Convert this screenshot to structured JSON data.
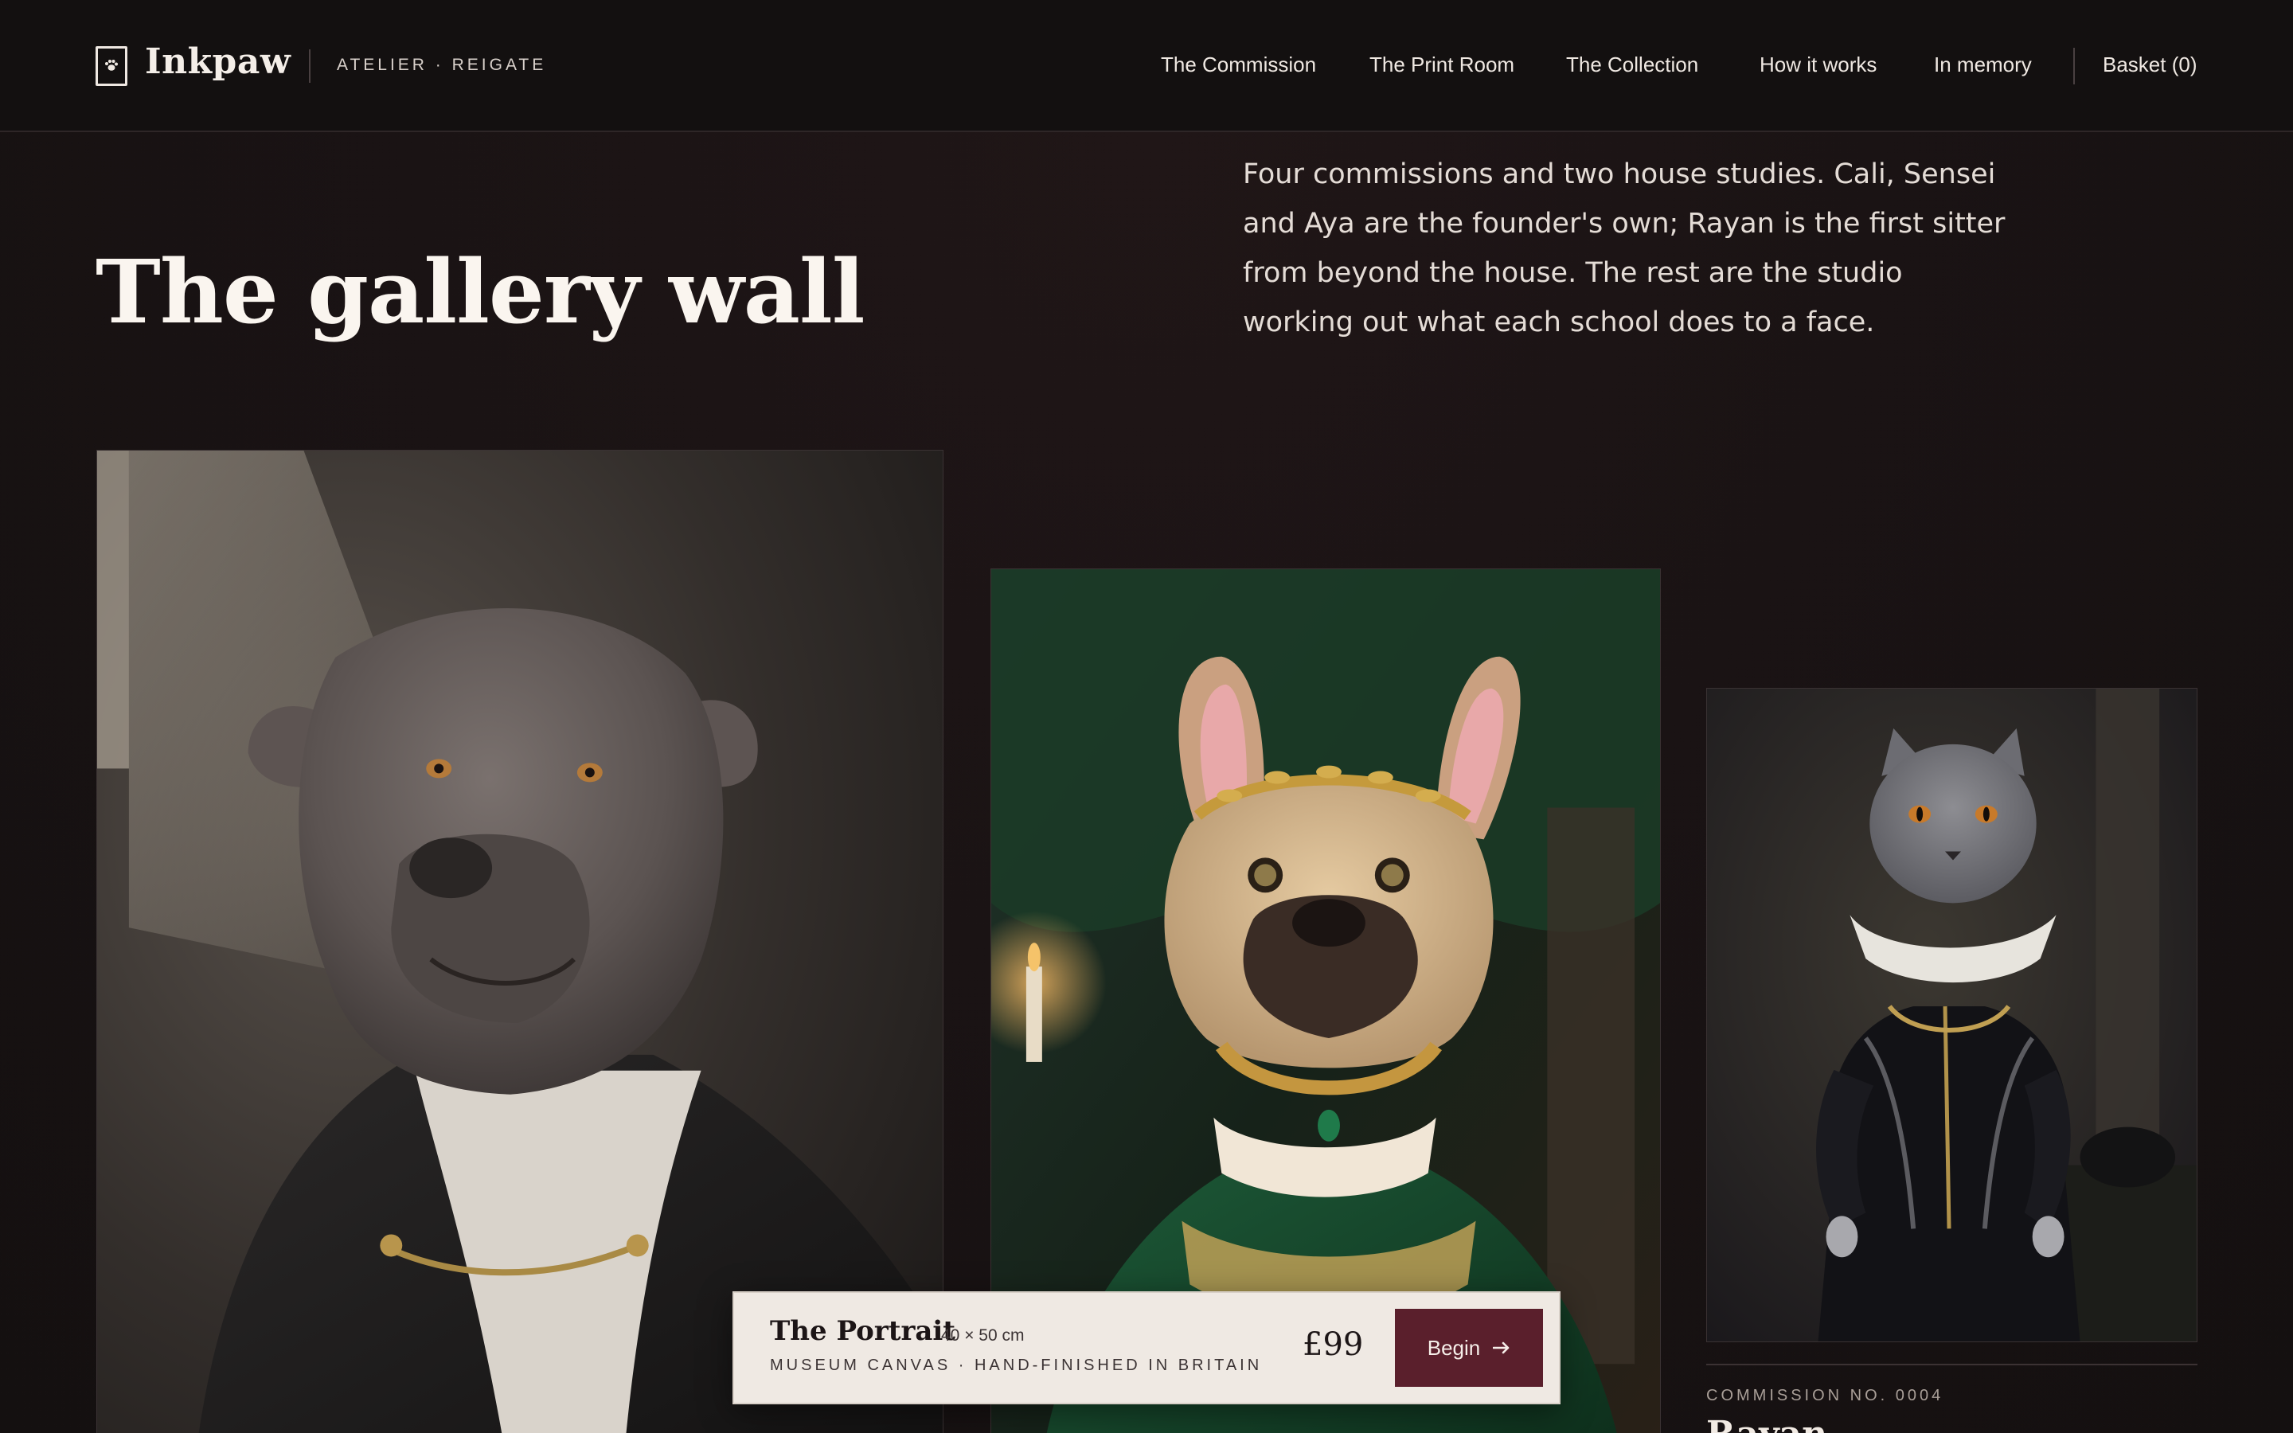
{
  "header": {
    "brand": "Inkpaw",
    "tagline": "ATELIER · REIGATE",
    "nav": [
      "The Commission",
      "The Print Room",
      "The Collection",
      "How it works",
      "In memory"
    ],
    "basket": "Basket (0)"
  },
  "hero": {
    "title": "The gallery wall",
    "intro": "Four commissions and two house studies. Cali, Sensei and Aya are the founder's own; Rayan is the first sitter from beyond the house. The rest are the studio working out what each school does to a face."
  },
  "gallery": {
    "portraits": [
      {
        "subject": "grey-pit-bull-in-black-cloak"
      },
      {
        "subject": "french-bulldog-queen-in-green-gown"
      },
      {
        "subject": "grey-cat-in-doublet-and-ruff"
      }
    ],
    "caption": {
      "label": "COMMISSION NO. 0004",
      "name": "Rayan"
    }
  },
  "buybar": {
    "title": "The Portrait",
    "size": "40 × 50 cm",
    "subtitle": "MUSEUM CANVAS · HAND-FINISHED IN BRITAIN",
    "price": "£99",
    "button_label": "Begin",
    "button_icon": "arrow-right-icon"
  },
  "colors": {
    "background": "#1a1314",
    "header": "#131010",
    "buybar": "#efe9e3",
    "accent": "#5a1f2c"
  }
}
